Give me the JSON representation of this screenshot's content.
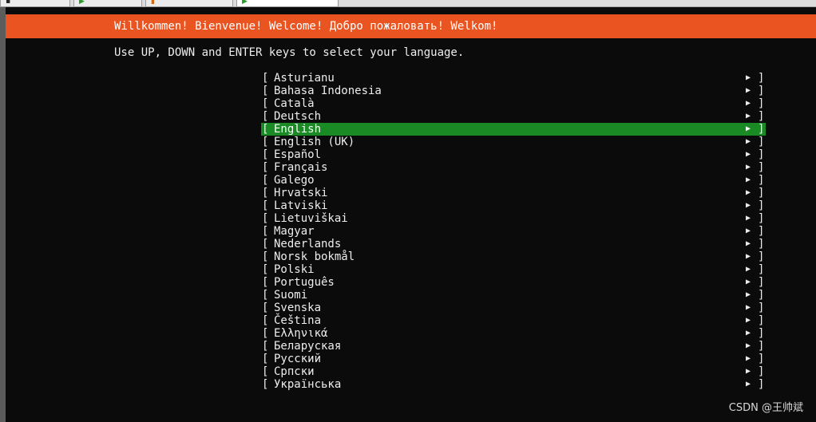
{
  "window_tabs": [
    "",
    "",
    "",
    ""
  ],
  "header": {
    "welcome_text": "Willkommen! Bienvenue! Welcome! Добро пожаловать! Welkom!",
    "color": "#e95420"
  },
  "instruction": "Use UP, DOWN and ENTER keys to select your language.",
  "list": {
    "left_bracket": "[",
    "right_bracket": "]",
    "arrow_icon": "▶",
    "selected_index": 4,
    "selected_color": "#1a8a24",
    "items": [
      {
        "label": "Asturianu"
      },
      {
        "label": "Bahasa Indonesia"
      },
      {
        "label": "Català"
      },
      {
        "label": "Deutsch"
      },
      {
        "label": "English"
      },
      {
        "label": "English (UK)"
      },
      {
        "label": "Español"
      },
      {
        "label": "Français"
      },
      {
        "label": "Galego"
      },
      {
        "label": "Hrvatski"
      },
      {
        "label": "Latviski"
      },
      {
        "label": "Lietuviškai"
      },
      {
        "label": "Magyar"
      },
      {
        "label": "Nederlands"
      },
      {
        "label": "Norsk bokmål"
      },
      {
        "label": "Polski"
      },
      {
        "label": "Português"
      },
      {
        "label": "Suomi"
      },
      {
        "label": "Svenska"
      },
      {
        "label": "Čeština"
      },
      {
        "label": "Ελληνικά"
      },
      {
        "label": "Беларуская"
      },
      {
        "label": "Русский"
      },
      {
        "label": "Српски"
      },
      {
        "label": "Українська"
      }
    ]
  },
  "watermark": "CSDN @王帅斌"
}
